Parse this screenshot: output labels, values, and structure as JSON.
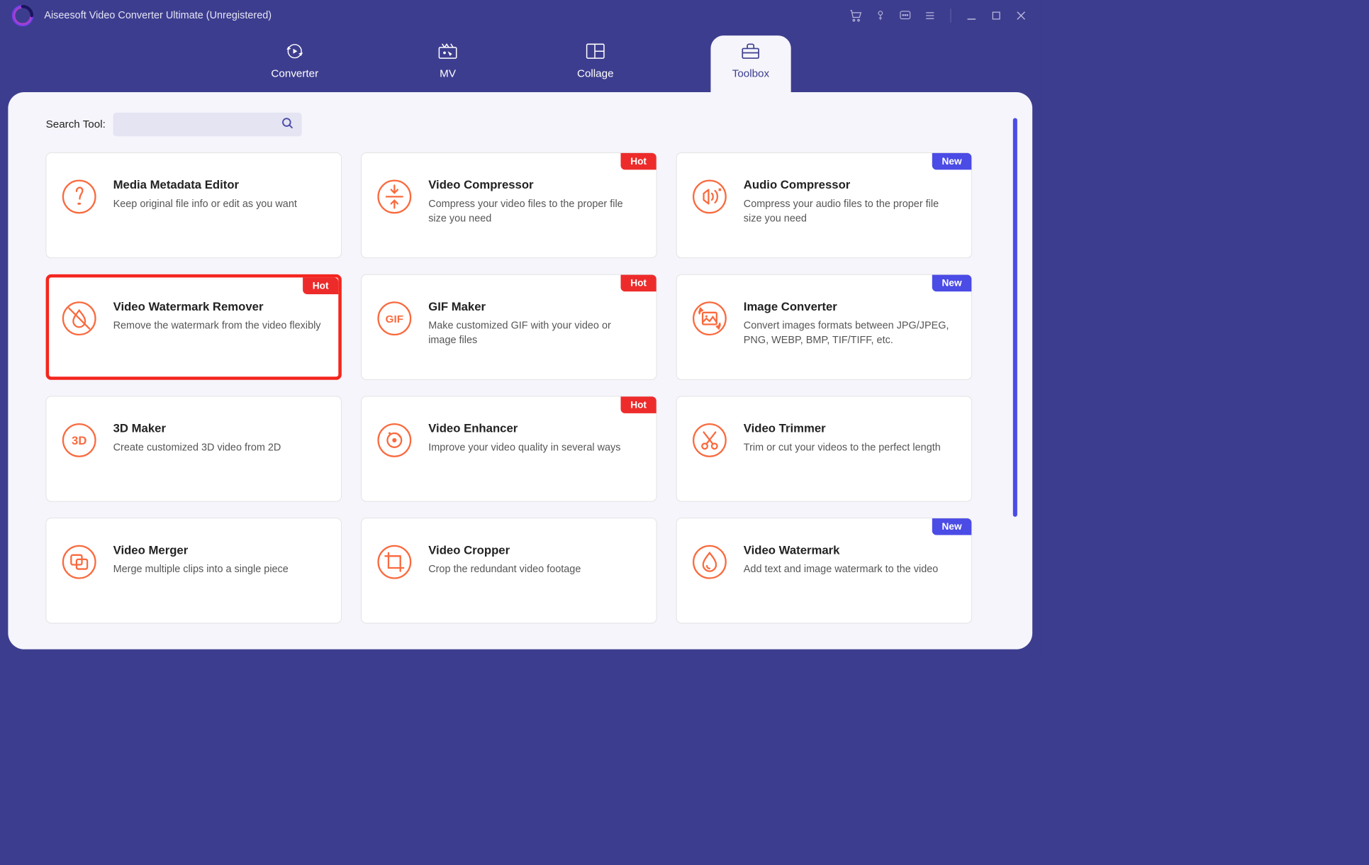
{
  "app": {
    "title": "Aiseesoft Video Converter Ultimate (Unregistered)"
  },
  "tabs": [
    {
      "label": "Converter"
    },
    {
      "label": "MV"
    },
    {
      "label": "Collage"
    },
    {
      "label": "Toolbox"
    }
  ],
  "search": {
    "label": "Search Tool:",
    "value": ""
  },
  "badges": {
    "hot": "Hot",
    "new": "New"
  },
  "tools": [
    {
      "title": "Media Metadata Editor",
      "desc": "Keep original file info or edit as you want",
      "badge": null,
      "icon": "info",
      "highlighted": false
    },
    {
      "title": "Video Compressor",
      "desc": "Compress your video files to the proper file size you need",
      "badge": "hot",
      "icon": "compress-v",
      "highlighted": false
    },
    {
      "title": "Audio Compressor",
      "desc": "Compress your audio files to the proper file size you need",
      "badge": "new",
      "icon": "compress-a",
      "highlighted": false
    },
    {
      "title": "Video Watermark Remover",
      "desc": "Remove the watermark from the video flexibly",
      "badge": "hot",
      "icon": "nowater",
      "highlighted": true
    },
    {
      "title": "GIF Maker",
      "desc": "Make customized GIF with your video or image files",
      "badge": "hot",
      "icon": "gif",
      "highlighted": false
    },
    {
      "title": "Image Converter",
      "desc": "Convert images formats between JPG/JPEG, PNG, WEBP, BMP, TIF/TIFF, etc.",
      "badge": "new",
      "icon": "imgconv",
      "highlighted": false
    },
    {
      "title": "3D Maker",
      "desc": "Create customized 3D video from 2D",
      "badge": null,
      "icon": "3d",
      "highlighted": false
    },
    {
      "title": "Video Enhancer",
      "desc": "Improve your video quality in several ways",
      "badge": "hot",
      "icon": "enhance",
      "highlighted": false
    },
    {
      "title": "Video Trimmer",
      "desc": "Trim or cut your videos to the perfect length",
      "badge": null,
      "icon": "trim",
      "highlighted": false
    },
    {
      "title": "Video Merger",
      "desc": "Merge multiple clips into a single piece",
      "badge": null,
      "icon": "merge",
      "highlighted": false
    },
    {
      "title": "Video Cropper",
      "desc": "Crop the redundant video footage",
      "badge": null,
      "icon": "crop",
      "highlighted": false
    },
    {
      "title": "Video Watermark",
      "desc": "Add text and image watermark to the video",
      "badge": "new",
      "icon": "water",
      "highlighted": false
    }
  ]
}
